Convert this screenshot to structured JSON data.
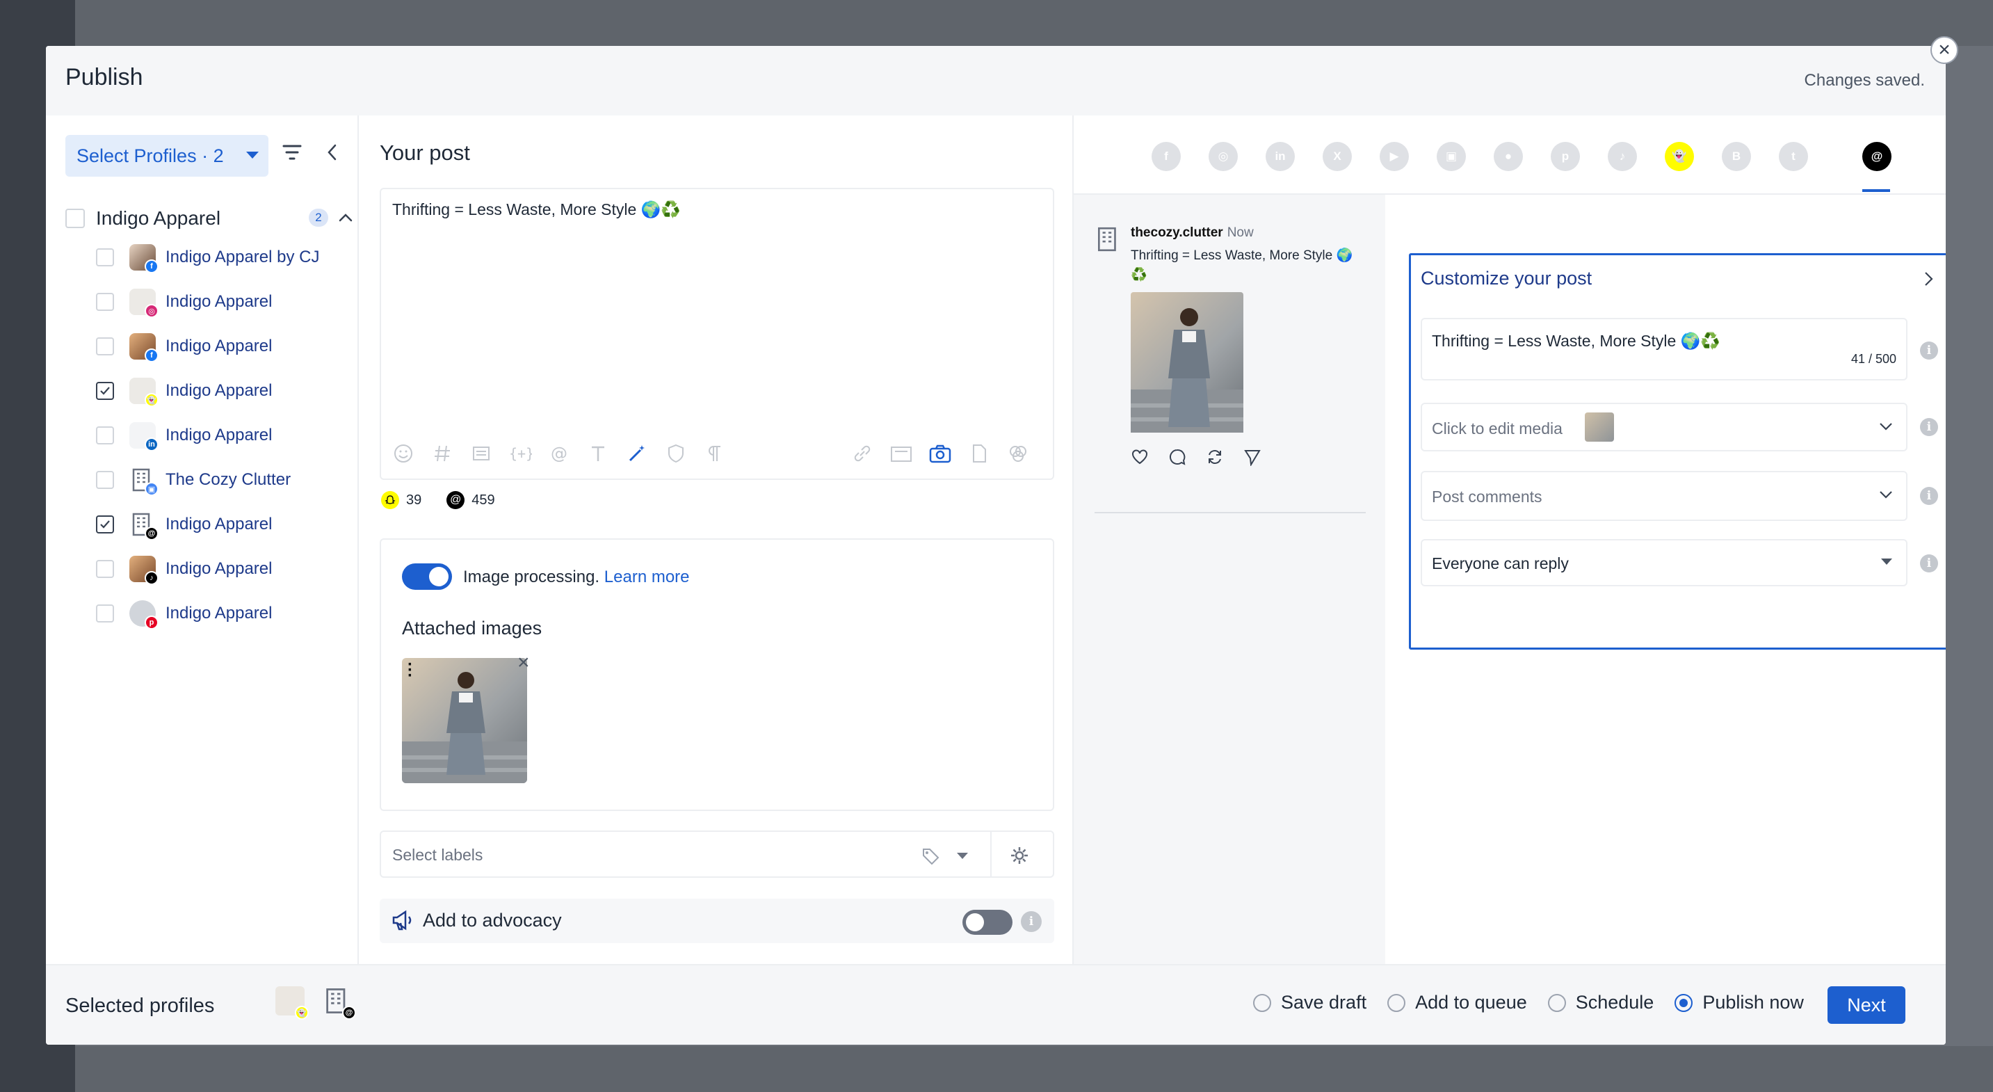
{
  "modal": {
    "title": "Publish",
    "status": "Changes saved.",
    "close_symbol": "×"
  },
  "profiles": {
    "select_label": "Select Profiles · 2",
    "group": {
      "name": "Indigo Apparel",
      "count": "2"
    },
    "items": [
      {
        "name": "Indigo Apparel by CJ",
        "network": "facebook",
        "checked": false
      },
      {
        "name": "Indigo Apparel",
        "network": "instagram",
        "checked": false
      },
      {
        "name": "Indigo Apparel",
        "network": "facebook",
        "checked": false
      },
      {
        "name": "Indigo Apparel",
        "network": "snapchat",
        "checked": true
      },
      {
        "name": "Indigo Apparel",
        "network": "linkedin",
        "checked": false
      },
      {
        "name": "The Cozy Clutter",
        "network": "google-business",
        "checked": false
      },
      {
        "name": "Indigo Apparel",
        "network": "threads",
        "checked": true
      },
      {
        "name": "Indigo Apparel",
        "network": "tiktok",
        "checked": false
      },
      {
        "name": "Indigo Apparel",
        "network": "pinterest",
        "checked": false
      }
    ]
  },
  "post": {
    "title": "Your post",
    "text": "Thrifting = Less Waste, More Style 🌍♻️",
    "counts": {
      "snapchat": "39",
      "threads": "459"
    },
    "image_processing": "Image processing.",
    "learn_more": "Learn more",
    "attached_images_title": "Attached images",
    "labels_placeholder": "Select labels",
    "advocacy_label": "Add to advocacy"
  },
  "preview": {
    "username": "thecozy.clutter",
    "time": "Now",
    "text": "Thrifting = Less Waste, More Style 🌍♻️"
  },
  "customize": {
    "title": "Customize your post",
    "text": "Thrifting = Less Waste, More Style 🌍♻️",
    "char_count": "41 / 500",
    "media_placeholder": "Click to edit media",
    "comments_placeholder": "Post comments",
    "reply_setting": "Everyone can reply"
  },
  "networks": [
    "facebook",
    "instagram",
    "linkedin",
    "x",
    "youtube",
    "google-business",
    "reddit",
    "pinterest",
    "tiktok",
    "snapchat",
    "bluesky",
    "tumblr",
    "threads"
  ],
  "footer": {
    "selected_label": "Selected profiles",
    "options": [
      {
        "label": "Save draft",
        "selected": false
      },
      {
        "label": "Add to queue",
        "selected": false
      },
      {
        "label": "Schedule",
        "selected": false
      },
      {
        "label": "Publish now",
        "selected": true
      }
    ],
    "next_label": "Next"
  },
  "colors": {
    "accent": "#1d5fcf",
    "snapchat": "#fffc00",
    "threads": "#000000"
  }
}
